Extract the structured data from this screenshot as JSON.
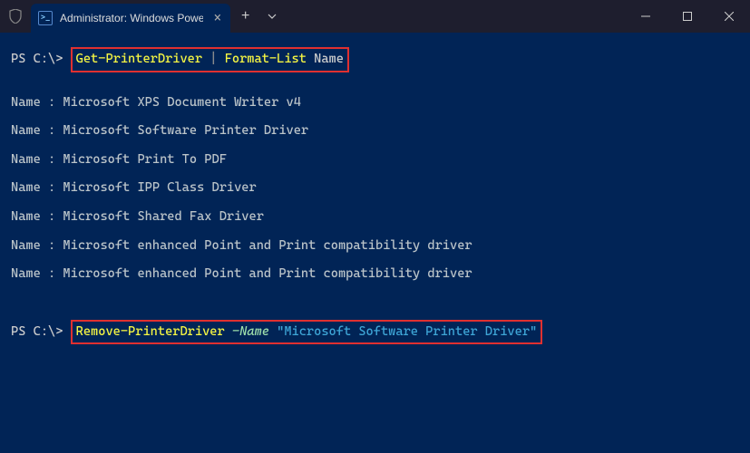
{
  "titlebar": {
    "tab_title": "Administrator: Windows Powe"
  },
  "terminal": {
    "prompt": "PS C:\\>",
    "cmd1": {
      "part1": "Get-PrinterDriver",
      "pipe": " | ",
      "part2": "Format-List",
      "arg": " Name"
    },
    "output_label": "Name : ",
    "drivers": [
      "Microsoft XPS Document Writer v4",
      "Microsoft Software Printer Driver",
      "Microsoft Print To PDF",
      "Microsoft IPP Class Driver",
      "Microsoft Shared Fax Driver",
      "Microsoft enhanced Point and Print compatibility driver",
      "Microsoft enhanced Point and Print compatibility driver"
    ],
    "cmd2": {
      "part1": "Remove-PrinterDriver",
      "param": " -Name ",
      "value": "\"Microsoft Software Printer Driver\""
    }
  }
}
